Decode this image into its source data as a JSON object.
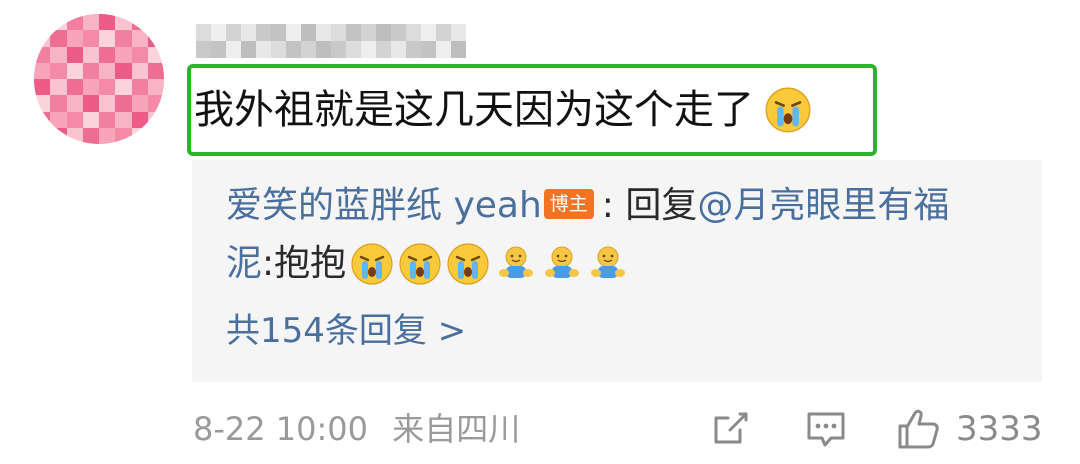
{
  "comment": {
    "text": "我外祖就是这几天因为这个走了",
    "emoji": "crying-face-icon"
  },
  "reply": {
    "author": "爱笑的蓝胖纸 yeah",
    "badge": "博主",
    "text_line1": " : 回复 ",
    "mention_line1": "@月亮眼里有福",
    "mention_line2": "泥",
    "text_line2": ":抱抱",
    "emojis": [
      "crying-face-icon",
      "crying-face-icon",
      "crying-face-icon",
      "hug-icon",
      "hug-icon",
      "hug-icon"
    ],
    "more_replies": "共154条回复 >"
  },
  "footer": {
    "time": "8-22 10:00",
    "source": "来自四川",
    "like_count": "3333"
  },
  "colors": {
    "highlight_border": "#2bb52b",
    "link_blue": "#4b6f9c",
    "badge_orange": "#f27321",
    "reply_bg": "#f5f5f5",
    "muted_gray": "#9a9a9a"
  }
}
